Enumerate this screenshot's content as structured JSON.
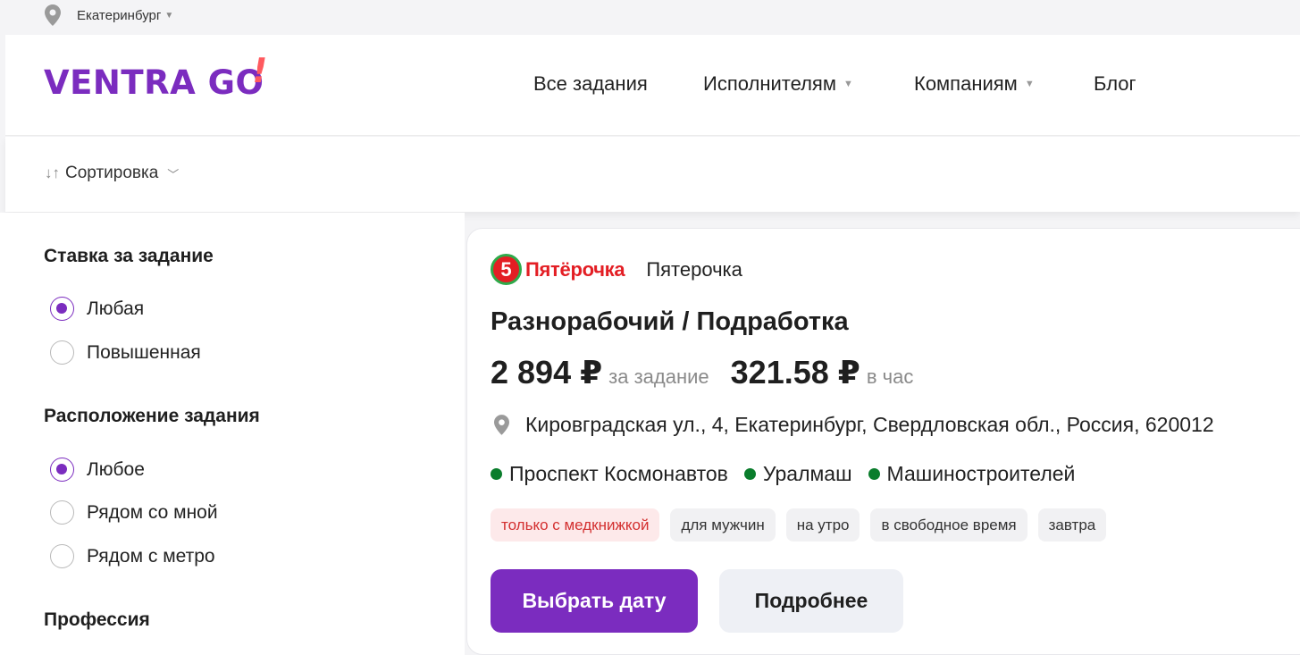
{
  "topbar": {
    "city": "Екатеринбург"
  },
  "header": {
    "logo": "VENTRA GO",
    "nav": [
      {
        "label": "Все задания",
        "has_dropdown": false
      },
      {
        "label": "Исполнителям",
        "has_dropdown": true
      },
      {
        "label": "Компаниям",
        "has_dropdown": true
      },
      {
        "label": "Блог",
        "has_dropdown": false
      }
    ]
  },
  "sort": {
    "label": "Сортировка"
  },
  "filters": {
    "rate": {
      "title": "Ставка за задание",
      "options": [
        {
          "label": "Любая",
          "selected": true
        },
        {
          "label": "Повышенная",
          "selected": false
        }
      ]
    },
    "location": {
      "title": "Расположение задания",
      "options": [
        {
          "label": "Любое",
          "selected": true
        },
        {
          "label": "Рядом со мной",
          "selected": false
        },
        {
          "label": "Рядом с метро",
          "selected": false
        }
      ]
    },
    "profession": {
      "title": "Профессия"
    }
  },
  "card": {
    "brand_logo_text": "Пятёрочка",
    "brand_logo_digit": "5",
    "company": "Пятерочка",
    "title": "Разнорабочий / Подработка",
    "pay_task": "2 894 ₽",
    "pay_task_unit": "за задание",
    "pay_hour": "321.58 ₽",
    "pay_hour_unit": "в час",
    "address": "Кировградская ул., 4, Екатеринбург, Свердловская обл., Россия, 620012",
    "metros": [
      "Проспект Космонавтов",
      "Уралмаш",
      "Машиностроителей"
    ],
    "tags": [
      {
        "label": "только с медкнижкой",
        "warn": true
      },
      {
        "label": "для мужчин",
        "warn": false
      },
      {
        "label": "на утро",
        "warn": false
      },
      {
        "label": "в свободное время",
        "warn": false
      },
      {
        "label": "завтра",
        "warn": false
      }
    ],
    "btn_primary": "Выбрать дату",
    "btn_secondary": "Подробнее"
  },
  "colors": {
    "accent": "#7b2cbf",
    "brand_red": "#e31e24",
    "metro_green": "#0a7d2c"
  }
}
